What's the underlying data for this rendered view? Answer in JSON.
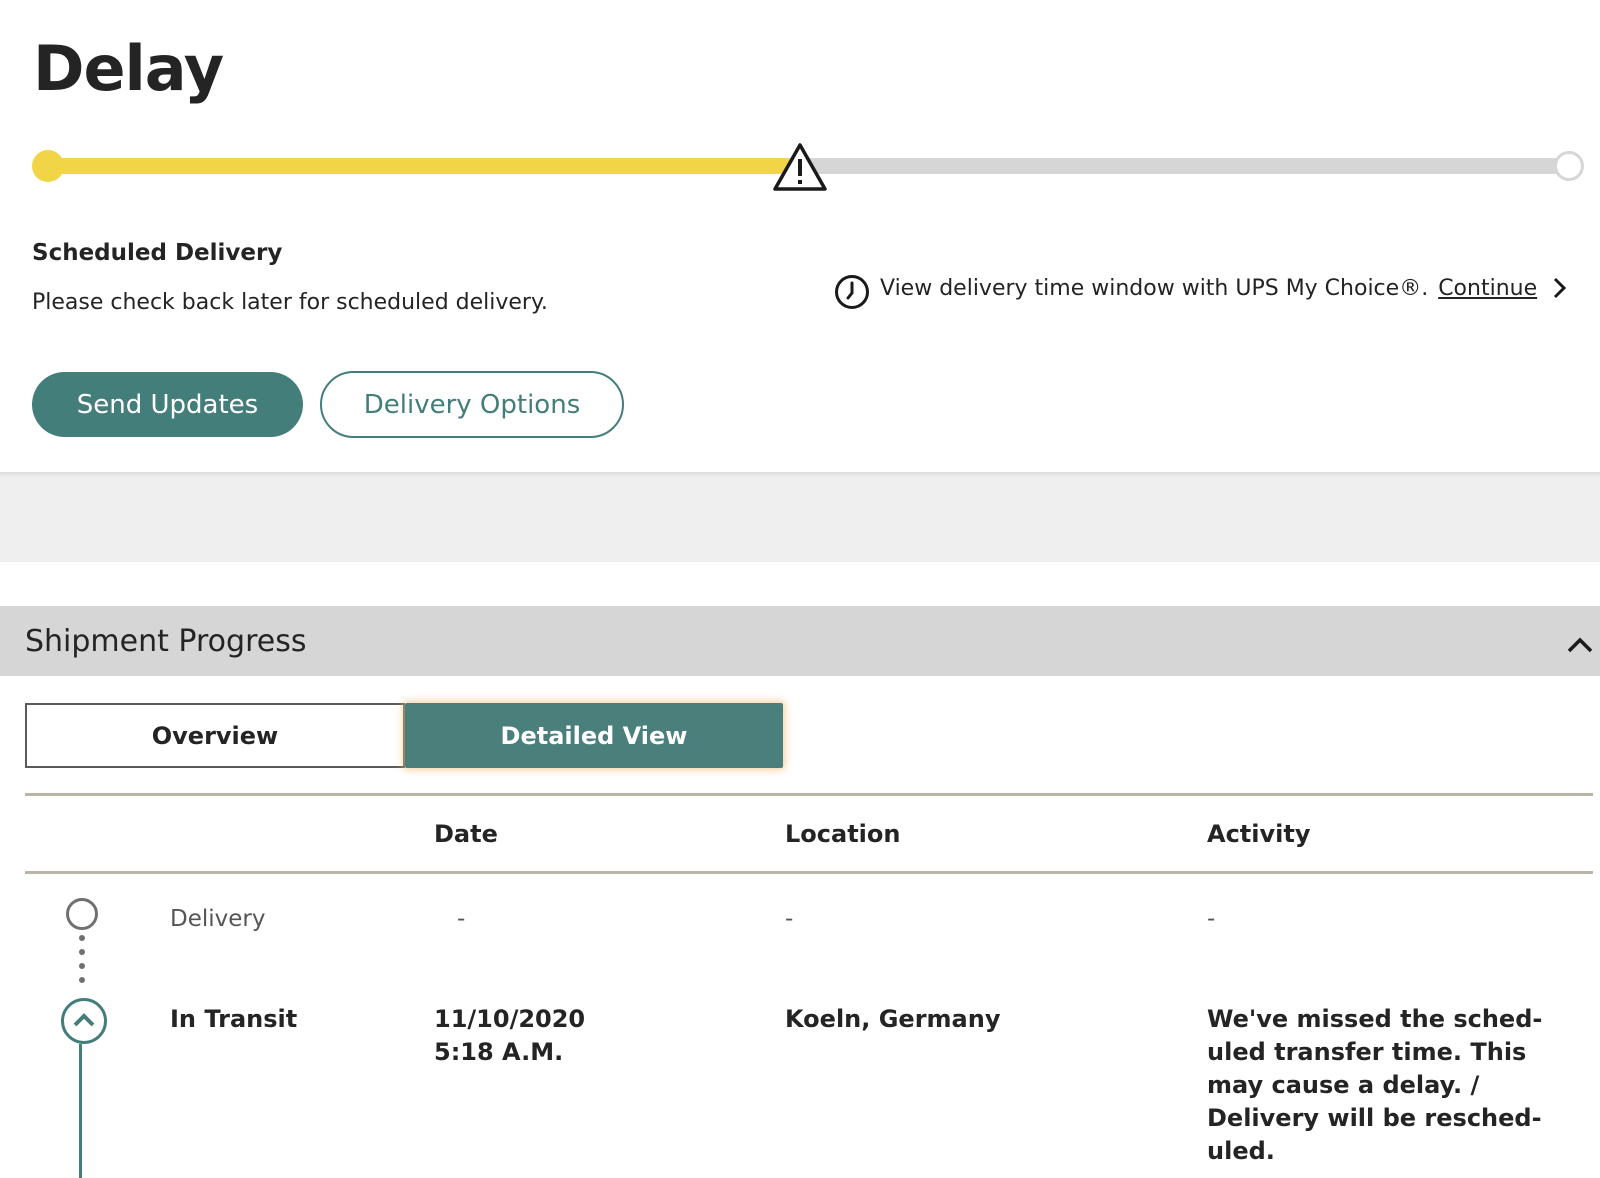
{
  "status": {
    "title": "Delay",
    "progress_fraction": 0.49
  },
  "scheduled": {
    "label": "Scheduled Delivery",
    "text": "Please check back later for scheduled delivery."
  },
  "my_choice": {
    "text": "View delivery time window with UPS My Choice®.",
    "link_label": "Continue"
  },
  "actions": {
    "send_updates": "Send Updates",
    "delivery_options": "Delivery Options"
  },
  "shipment_progress": {
    "title": "Shipment Progress",
    "tabs": [
      {
        "label": "Overview",
        "active": false
      },
      {
        "label": "Detailed View",
        "active": true
      }
    ],
    "columns": {
      "date": "Date",
      "location": "Location",
      "activity": "Activity"
    },
    "rows": [
      {
        "status": "Delivery",
        "date": "-",
        "time": "",
        "location": "-",
        "activity": "-"
      },
      {
        "status": "In Transit",
        "date": "11/10/2020",
        "time": "5:18 A.M.",
        "location": "Koeln, Germany",
        "activity": "We've missed the sched-uled transfer time. This may cause a delay. / Delivery will be resched-uled."
      }
    ]
  },
  "colors": {
    "accent": "#447e7b",
    "progress": "#f2d546",
    "track": "#d6d6d6"
  }
}
